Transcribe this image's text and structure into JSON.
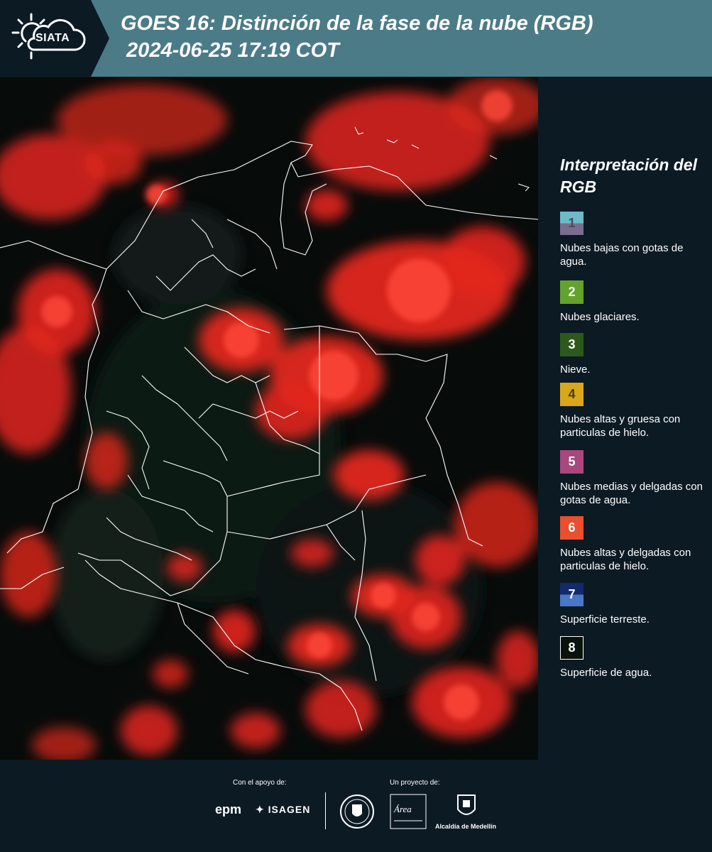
{
  "header": {
    "logo_text": "SIATA",
    "title_line1": "GOES 16: Distinción de la fase de la nube (RGB)",
    "title_line2": " 2024-06-25 17:19 COT"
  },
  "legend": {
    "title": "Interpretación del RGB",
    "items": [
      {
        "number": "1",
        "label": "Nubes bajas con gotas de agua.",
        "color_top": "#6bbcc8",
        "color_bottom": "#7a6d8e",
        "text_color": "#4a4a5a"
      },
      {
        "number": "2",
        "label": "Nubes glaciares.",
        "color_top": "#64a22e",
        "color_bottom": "#64a22e",
        "text_color": "#ffffff"
      },
      {
        "number": "3",
        "label": "Nieve.",
        "color_top": "#2d5a1c",
        "color_bottom": "#2d5a1c",
        "text_color": "#ffffff"
      },
      {
        "number": "4",
        "label": "Nubes altas y gruesa con particulas de hielo.",
        "color_top": "#d9a71a",
        "color_bottom": "#d9a71a",
        "text_color": "#4a3a10"
      },
      {
        "number": "5",
        "label": "Nubes medias y delgadas con gotas de agua.",
        "color_top": "#a8487f",
        "color_bottom": "#a8487f",
        "text_color": "#ffffff"
      },
      {
        "number": "6",
        "label": "Nubes altas y delgadas con particulas de hielo.",
        "color_top": "#e8502e",
        "color_bottom": "#e8502e",
        "text_color": "#ffffff"
      },
      {
        "number": "7",
        "label": "Superficie terreste.",
        "color_top": "#142a6e",
        "color_bottom": "#4a78c8",
        "text_color": "#ffffff"
      },
      {
        "number": "8",
        "label": "Superficie de agua.",
        "color_top": "#0a120c",
        "color_bottom": "#0a120c",
        "text_color": "#ffffff"
      }
    ]
  },
  "footer": {
    "support_label": "Con el apoyo de:",
    "project_label": "Un proyecto de:",
    "epm": "epm",
    "isagen": "ISAGEN",
    "area_text": "Área",
    "alcaldia": "Alcaldía de Medellín"
  }
}
